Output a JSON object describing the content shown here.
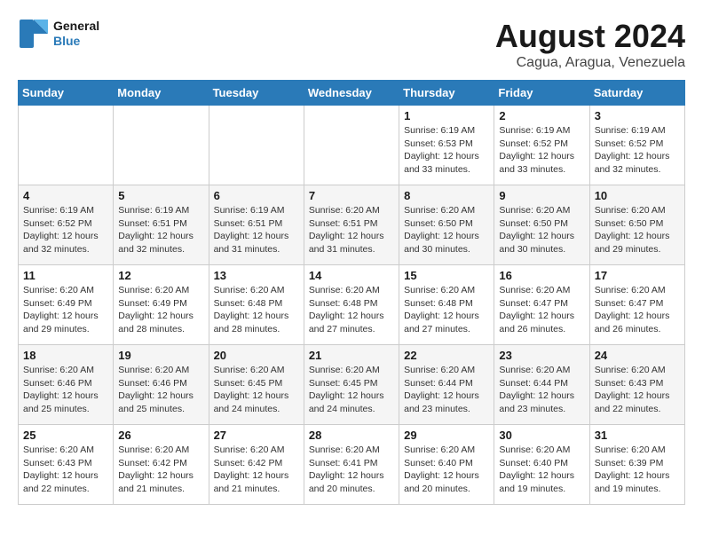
{
  "logo": {
    "line1": "General",
    "line2": "Blue"
  },
  "title": "August 2024",
  "location": "Cagua, Aragua, Venezuela",
  "days_of_week": [
    "Sunday",
    "Monday",
    "Tuesday",
    "Wednesday",
    "Thursday",
    "Friday",
    "Saturday"
  ],
  "weeks": [
    [
      {
        "day": "",
        "info": ""
      },
      {
        "day": "",
        "info": ""
      },
      {
        "day": "",
        "info": ""
      },
      {
        "day": "",
        "info": ""
      },
      {
        "day": "1",
        "info": "Sunrise: 6:19 AM\nSunset: 6:53 PM\nDaylight: 12 hours and 33 minutes."
      },
      {
        "day": "2",
        "info": "Sunrise: 6:19 AM\nSunset: 6:52 PM\nDaylight: 12 hours and 33 minutes."
      },
      {
        "day": "3",
        "info": "Sunrise: 6:19 AM\nSunset: 6:52 PM\nDaylight: 12 hours and 32 minutes."
      }
    ],
    [
      {
        "day": "4",
        "info": "Sunrise: 6:19 AM\nSunset: 6:52 PM\nDaylight: 12 hours and 32 minutes."
      },
      {
        "day": "5",
        "info": "Sunrise: 6:19 AM\nSunset: 6:51 PM\nDaylight: 12 hours and 32 minutes."
      },
      {
        "day": "6",
        "info": "Sunrise: 6:19 AM\nSunset: 6:51 PM\nDaylight: 12 hours and 31 minutes."
      },
      {
        "day": "7",
        "info": "Sunrise: 6:20 AM\nSunset: 6:51 PM\nDaylight: 12 hours and 31 minutes."
      },
      {
        "day": "8",
        "info": "Sunrise: 6:20 AM\nSunset: 6:50 PM\nDaylight: 12 hours and 30 minutes."
      },
      {
        "day": "9",
        "info": "Sunrise: 6:20 AM\nSunset: 6:50 PM\nDaylight: 12 hours and 30 minutes."
      },
      {
        "day": "10",
        "info": "Sunrise: 6:20 AM\nSunset: 6:50 PM\nDaylight: 12 hours and 29 minutes."
      }
    ],
    [
      {
        "day": "11",
        "info": "Sunrise: 6:20 AM\nSunset: 6:49 PM\nDaylight: 12 hours and 29 minutes."
      },
      {
        "day": "12",
        "info": "Sunrise: 6:20 AM\nSunset: 6:49 PM\nDaylight: 12 hours and 28 minutes."
      },
      {
        "day": "13",
        "info": "Sunrise: 6:20 AM\nSunset: 6:48 PM\nDaylight: 12 hours and 28 minutes."
      },
      {
        "day": "14",
        "info": "Sunrise: 6:20 AM\nSunset: 6:48 PM\nDaylight: 12 hours and 27 minutes."
      },
      {
        "day": "15",
        "info": "Sunrise: 6:20 AM\nSunset: 6:48 PM\nDaylight: 12 hours and 27 minutes."
      },
      {
        "day": "16",
        "info": "Sunrise: 6:20 AM\nSunset: 6:47 PM\nDaylight: 12 hours and 26 minutes."
      },
      {
        "day": "17",
        "info": "Sunrise: 6:20 AM\nSunset: 6:47 PM\nDaylight: 12 hours and 26 minutes."
      }
    ],
    [
      {
        "day": "18",
        "info": "Sunrise: 6:20 AM\nSunset: 6:46 PM\nDaylight: 12 hours and 25 minutes."
      },
      {
        "day": "19",
        "info": "Sunrise: 6:20 AM\nSunset: 6:46 PM\nDaylight: 12 hours and 25 minutes."
      },
      {
        "day": "20",
        "info": "Sunrise: 6:20 AM\nSunset: 6:45 PM\nDaylight: 12 hours and 24 minutes."
      },
      {
        "day": "21",
        "info": "Sunrise: 6:20 AM\nSunset: 6:45 PM\nDaylight: 12 hours and 24 minutes."
      },
      {
        "day": "22",
        "info": "Sunrise: 6:20 AM\nSunset: 6:44 PM\nDaylight: 12 hours and 23 minutes."
      },
      {
        "day": "23",
        "info": "Sunrise: 6:20 AM\nSunset: 6:44 PM\nDaylight: 12 hours and 23 minutes."
      },
      {
        "day": "24",
        "info": "Sunrise: 6:20 AM\nSunset: 6:43 PM\nDaylight: 12 hours and 22 minutes."
      }
    ],
    [
      {
        "day": "25",
        "info": "Sunrise: 6:20 AM\nSunset: 6:43 PM\nDaylight: 12 hours and 22 minutes."
      },
      {
        "day": "26",
        "info": "Sunrise: 6:20 AM\nSunset: 6:42 PM\nDaylight: 12 hours and 21 minutes."
      },
      {
        "day": "27",
        "info": "Sunrise: 6:20 AM\nSunset: 6:42 PM\nDaylight: 12 hours and 21 minutes."
      },
      {
        "day": "28",
        "info": "Sunrise: 6:20 AM\nSunset: 6:41 PM\nDaylight: 12 hours and 20 minutes."
      },
      {
        "day": "29",
        "info": "Sunrise: 6:20 AM\nSunset: 6:40 PM\nDaylight: 12 hours and 20 minutes."
      },
      {
        "day": "30",
        "info": "Sunrise: 6:20 AM\nSunset: 6:40 PM\nDaylight: 12 hours and 19 minutes."
      },
      {
        "day": "31",
        "info": "Sunrise: 6:20 AM\nSunset: 6:39 PM\nDaylight: 12 hours and 19 minutes."
      }
    ]
  ]
}
